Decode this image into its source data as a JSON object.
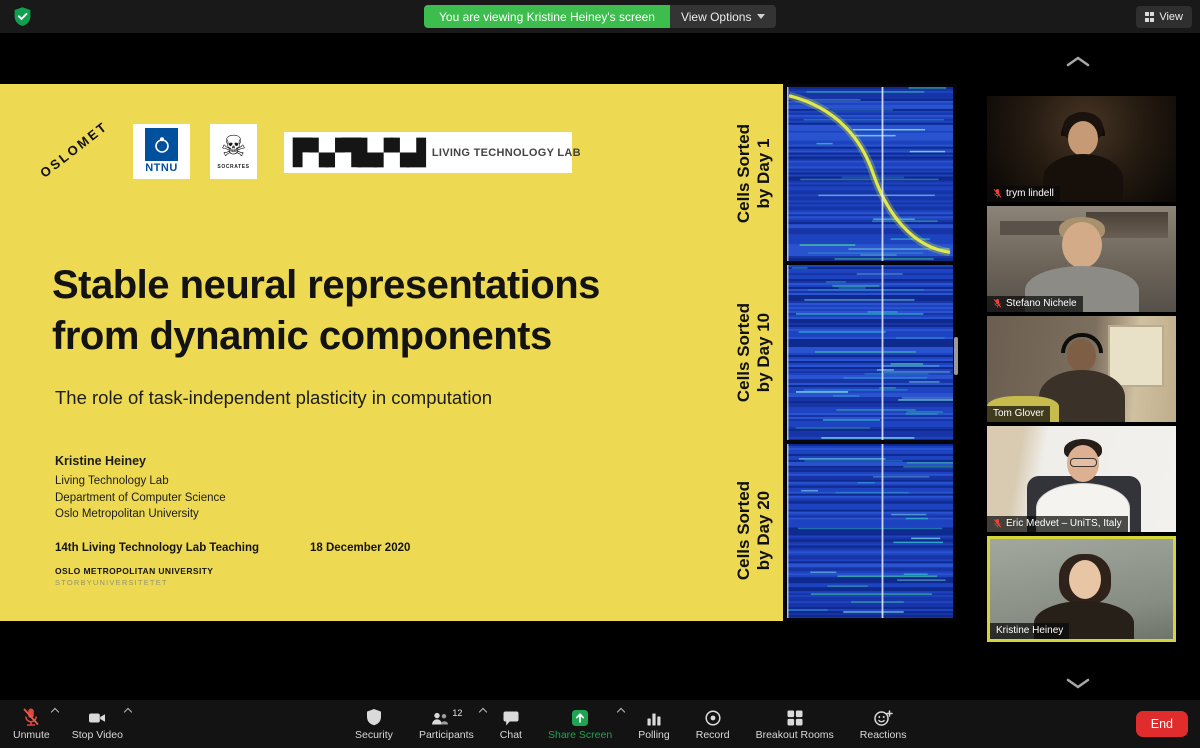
{
  "top_bar": {
    "viewing_banner": "You are viewing Kristine Heiney's screen",
    "view_options_label": "View Options",
    "view_button_label": "View"
  },
  "slide": {
    "logos": {
      "oslomet": "OSLOMET",
      "ntnu": "NTNU",
      "socrates_glyph": "☠",
      "socrates": "SOCRATES",
      "ltl_glyphs": "▛▚▞▜▙▞▚▟",
      "ltl_caption": "LIVING TECHNOLOGY LAB"
    },
    "title_line1": "Stable neural representations",
    "title_line2": "from dynamic components",
    "subtitle": "The role of task-independent plasticity in computation",
    "author": {
      "name": "Kristine Heiney",
      "line1": "Living Technology Lab",
      "line2": "Department of Computer Science",
      "line3": "Oslo Metropolitan University"
    },
    "footer": {
      "event": "14th Living Technology Lab Teaching",
      "date": "18 December 2020",
      "university": "OSLO METROPOLITAN UNIVERSITY",
      "university_sub": "STORBYUNIVERSITETET"
    },
    "heatmaps": [
      {
        "label_line1": "Cells Sorted",
        "label_line2": "by Day 1"
      },
      {
        "label_line1": "Cells Sorted",
        "label_line2": "by Day 10"
      },
      {
        "label_line1": "Cells Sorted",
        "label_line2": "by Day 20"
      }
    ]
  },
  "participants_panel": {
    "tiles": [
      {
        "name": "trym lindell",
        "muted": true,
        "active": false
      },
      {
        "name": "Stefano Nichele",
        "muted": true,
        "active": false
      },
      {
        "name": "Tom Glover",
        "muted": false,
        "active": false
      },
      {
        "name": "Eric Medvet – UniTS, Italy",
        "muted": true,
        "active": false
      },
      {
        "name": "Kristine Heiney",
        "muted": false,
        "active": true
      }
    ]
  },
  "toolbar": {
    "unmute": "Unmute",
    "stop_video": "Stop Video",
    "security": "Security",
    "participants": "Participants",
    "participants_count": "12",
    "chat": "Chat",
    "share_screen": "Share Screen",
    "polling": "Polling",
    "record": "Record",
    "breakout_rooms": "Breakout Rooms",
    "reactions": "Reactions",
    "end": "End"
  },
  "colors": {
    "banner_green": "#3DBD4E",
    "slide_yellow": "#EDD952",
    "heatmap_blue": "#1B3DB5",
    "share_green": "#1FA452",
    "end_red": "#E02C2C",
    "active_speaker_border": "#D3D53A",
    "muted_red": "#E8443A"
  }
}
